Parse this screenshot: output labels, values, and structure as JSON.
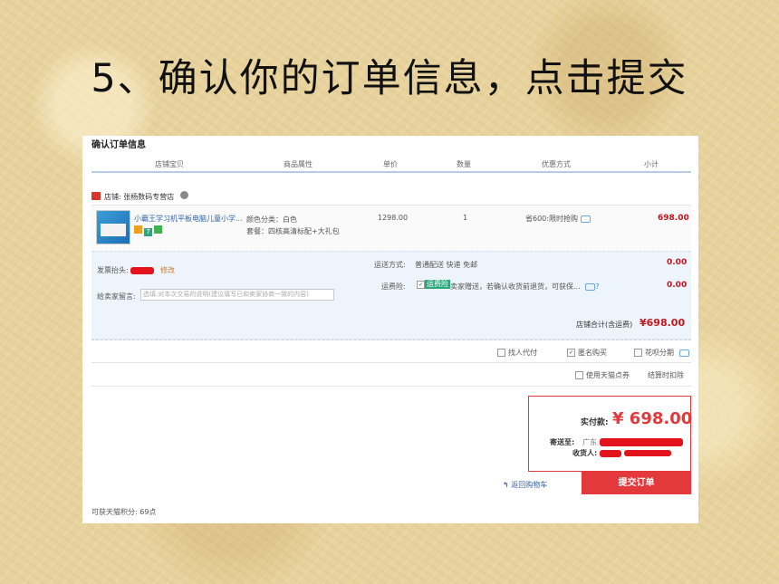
{
  "slide_title": "5、确认你的订单信息，点击提交",
  "section_title": "确认订单信息",
  "columns": [
    "店铺宝贝",
    "商品属性",
    "单价",
    "数量",
    "优惠方式",
    "小计"
  ],
  "shop": {
    "label": "店铺: 张杨数码专营店"
  },
  "item": {
    "title": "小霸王学习机平板电脑儿童小学...",
    "badges": [
      "",
      "7",
      ""
    ],
    "attr_color": "颜色分类：白色",
    "attr_package": "套餐：四核高清标配+大礼包",
    "price": "1298.00",
    "qty": "1",
    "promo": "省600:限时抢购",
    "subtotal": "698.00"
  },
  "invoice": {
    "label": "发票抬头:",
    "edit": "修改"
  },
  "shipping": {
    "label": "运送方式:",
    "value": "普通配送 快递 免邮",
    "amount": "0.00"
  },
  "insurance": {
    "label": "运费险:",
    "tag": "运费险",
    "text": "卖家赠送，若确认收货前退货，可获保...",
    "amount": "0.00"
  },
  "message": {
    "label": "给卖家留言:",
    "placeholder": "选填:对本次交易的说明(建议填写已和卖家协商一致的内容)"
  },
  "shop_total": {
    "label": "店铺合计(含运费)",
    "value": "¥698.00"
  },
  "options": {
    "pay_for_other": "找人代付",
    "anonymous": "匿名购买",
    "huabei": "花呗分期",
    "tmall_points": "使用天猫点券",
    "settle_points": "结算时扣除"
  },
  "payment": {
    "label": "实付款:",
    "amount": "¥ 698.00",
    "address_label": "寄送至:",
    "address_value": "广东",
    "receiver_label": "收货人:"
  },
  "back_link": "返回购物车",
  "submit_label": "提交订单",
  "points_text": "可获天猫积分: 69点",
  "colors": {
    "accent": "#e4393c",
    "price": "#c4161c",
    "link": "#3366aa"
  }
}
